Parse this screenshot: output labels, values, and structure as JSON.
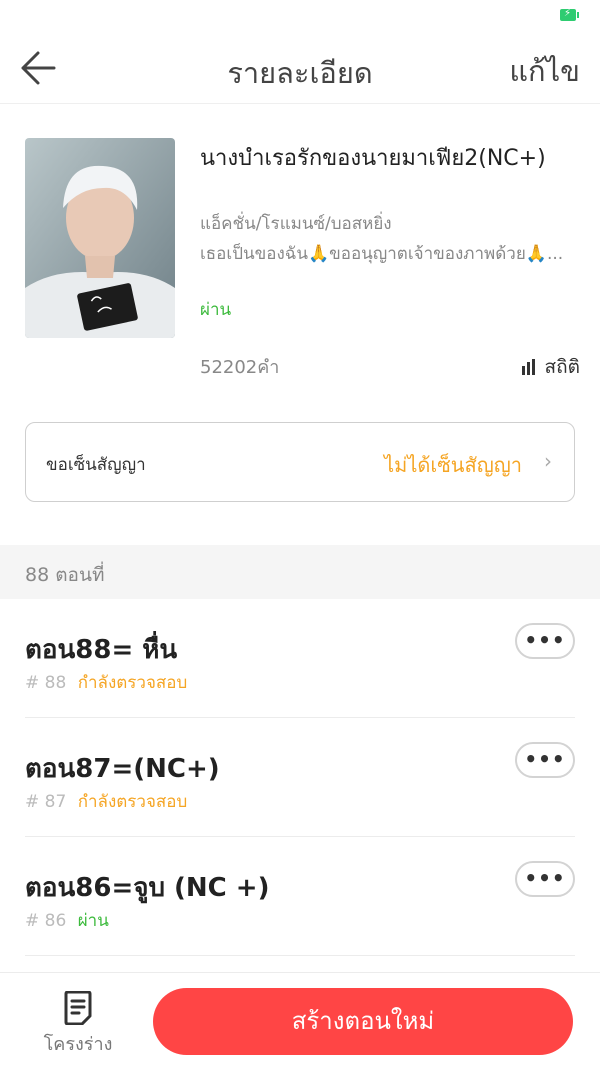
{
  "status_bar": {
    "battery_color": "#2ecc71"
  },
  "nav": {
    "title": "รายละเอียด",
    "edit_label": "แก้ไข"
  },
  "book": {
    "title": "นางบำเรอรักของนายมาเฟีย2(NC+)",
    "genre": "แอ็คชั่น/โรแมนซ์/บอสหยิ่ง",
    "description": "เธอเป็นของฉัน🙏ขออนุญาตเจ้าของภาพด้วย🙏...",
    "status": "ผ่าน",
    "word_count": "52202คำ",
    "stats_label": "สถิติ"
  },
  "contract": {
    "label": "ขอเซ็นสัญญา",
    "value": "ไม่ได้เซ็นสัญญา"
  },
  "chapters_section": {
    "label": "88 ตอนที่"
  },
  "chapters": [
    {
      "title": "ตอน88= หื่น",
      "number": "# 88",
      "status": "กำลังตรวจสอบ",
      "more": "•••"
    },
    {
      "title": "ตอน87=(NC+)",
      "number": "# 87",
      "status": "กำลังตรวจสอบ",
      "more": "•••"
    },
    {
      "title": "ตอน86=จูบ (NC +)",
      "number": "# 86",
      "status": "ผ่าน",
      "more": "•••"
    }
  ],
  "bottom": {
    "draft_label": "โครงร่าง",
    "create_label": "สร้างตอนใหม่"
  },
  "colors": {
    "accent": "#ff4545",
    "pending": "#f5a524",
    "pass": "#3cba3c"
  }
}
